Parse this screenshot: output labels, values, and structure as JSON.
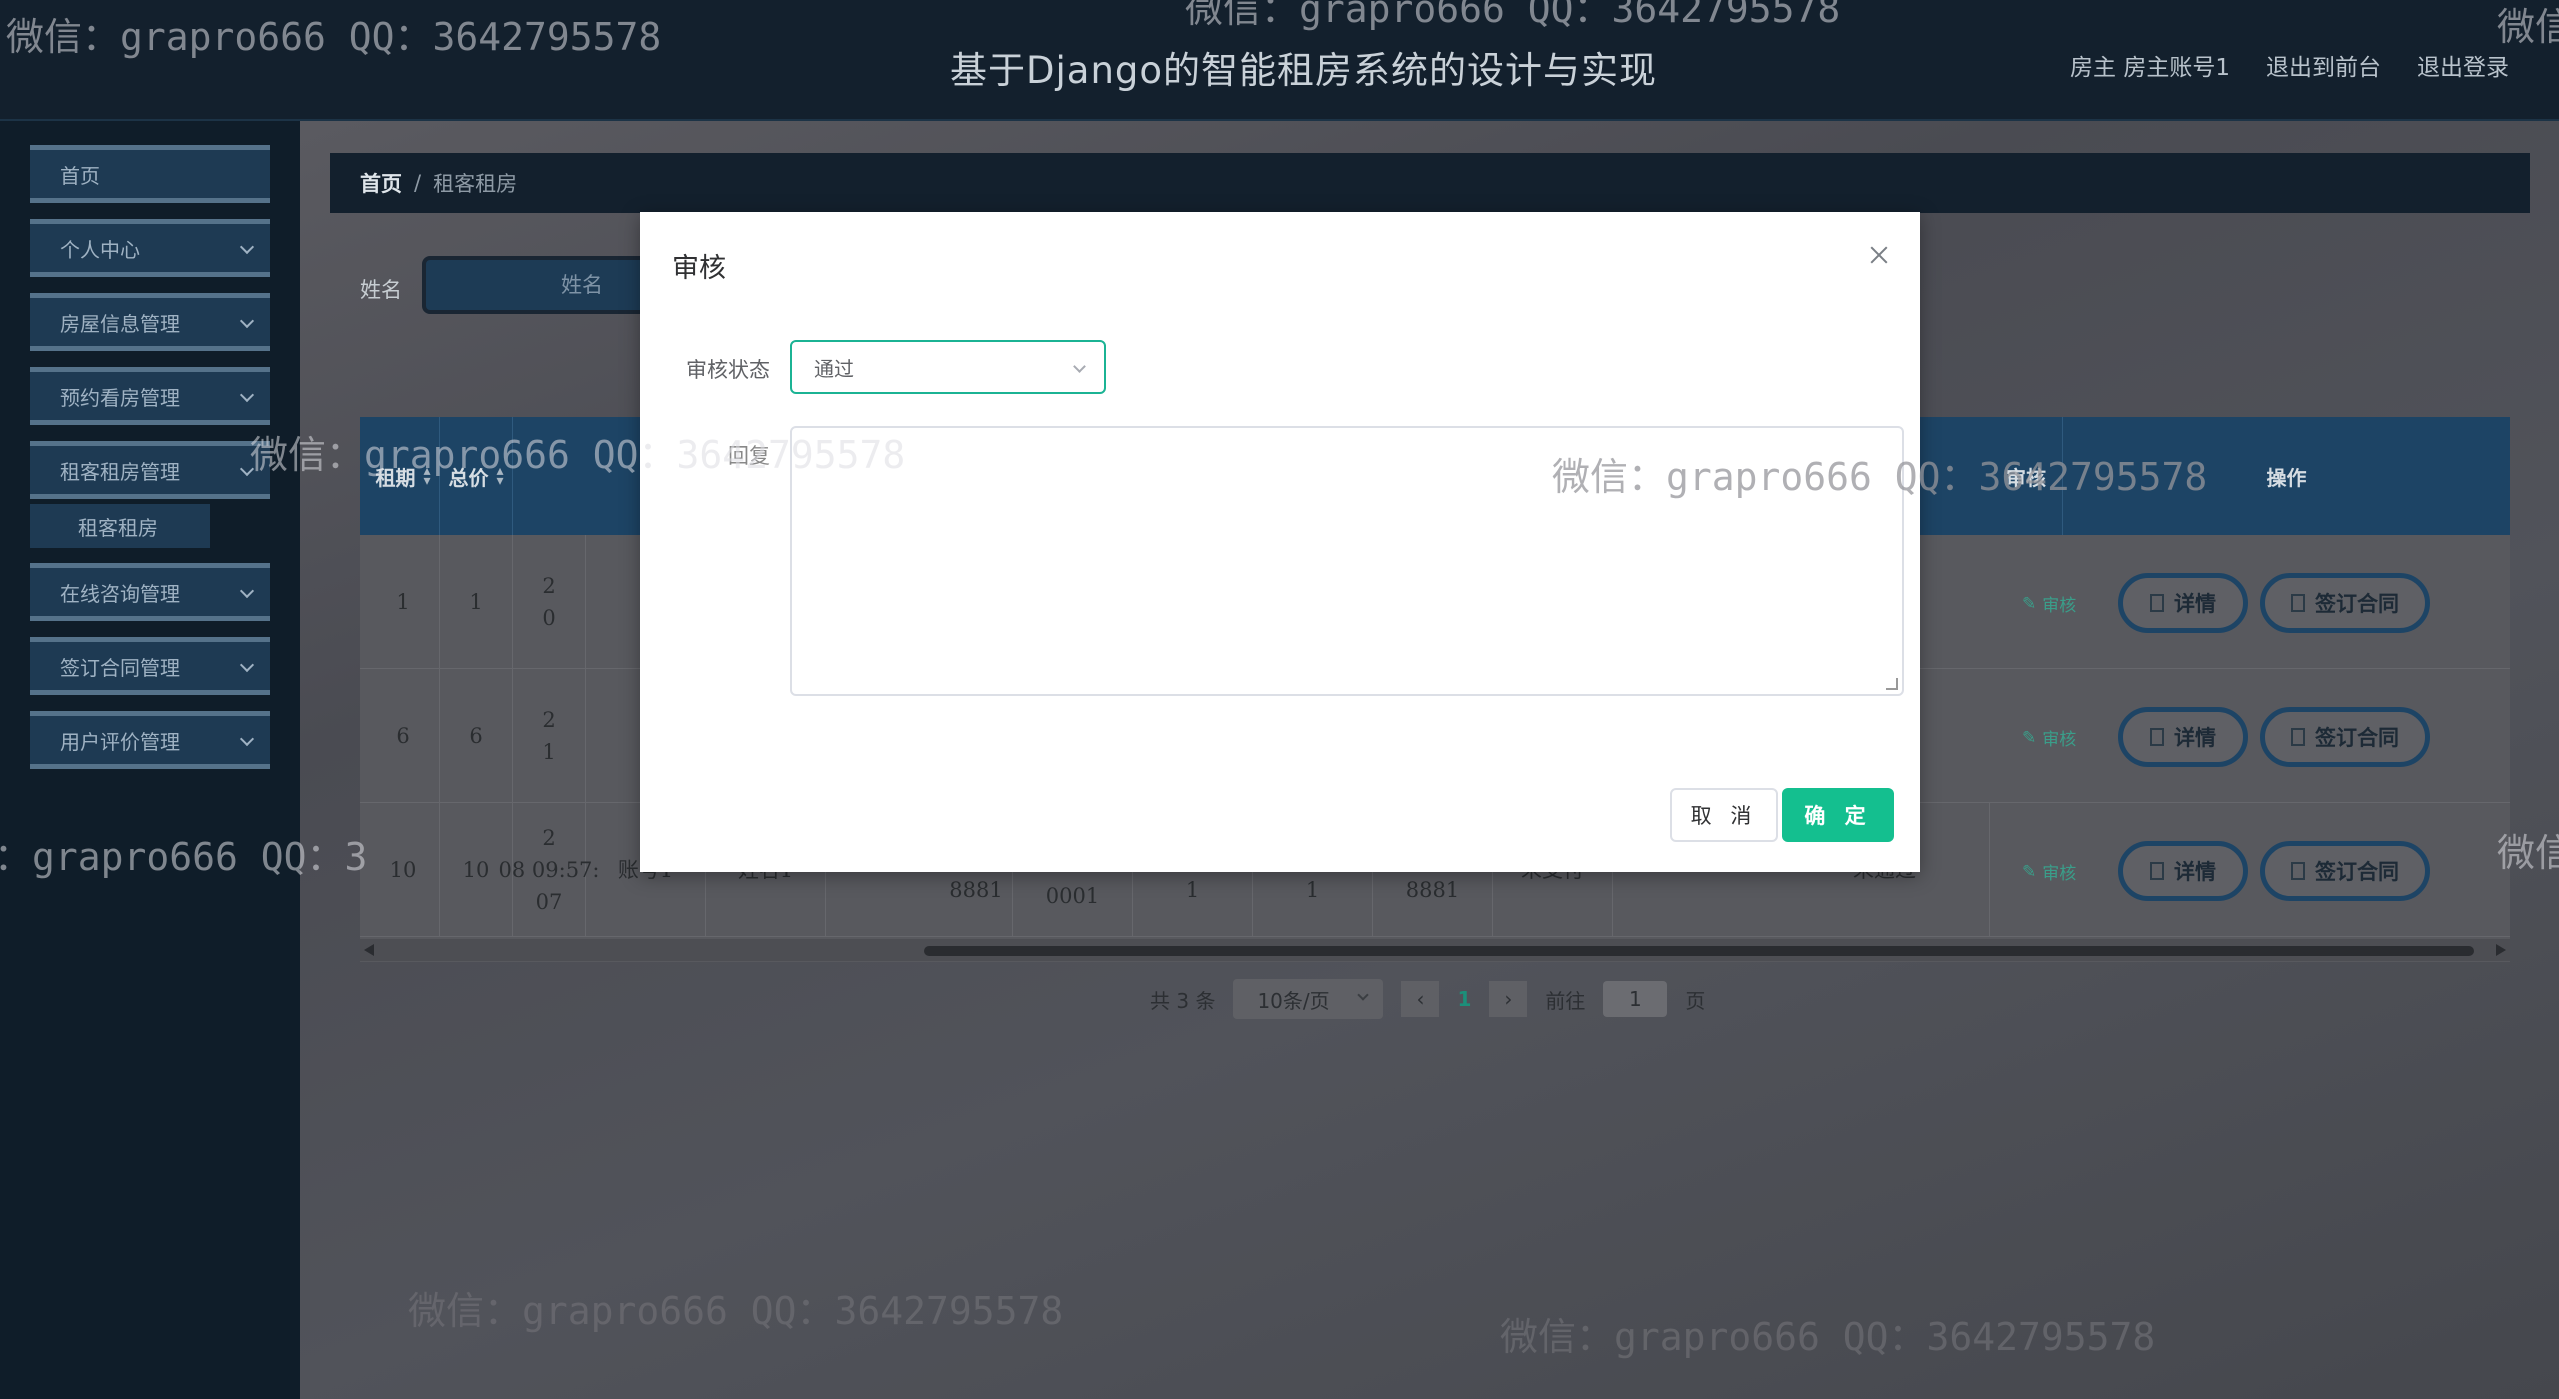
{
  "header": {
    "title": "基于Django的智能租房系统的设计与实现",
    "user_links": [
      "房主 房主账号1",
      "退出到前台",
      "退出登录"
    ]
  },
  "sidebar": {
    "items": [
      {
        "label": "首页",
        "has_arrow": false
      },
      {
        "label": "个人中心",
        "has_arrow": true
      },
      {
        "label": "房屋信息管理",
        "has_arrow": true
      },
      {
        "label": "预约看房管理",
        "has_arrow": true
      },
      {
        "label": "租客租房管理",
        "has_arrow": true
      },
      {
        "label": "在线咨询管理",
        "has_arrow": true
      },
      {
        "label": "签订合同管理",
        "has_arrow": true
      },
      {
        "label": "用户评价管理",
        "has_arrow": true
      }
    ],
    "sub_item": "租客租房"
  },
  "breadcrumb": {
    "home": "首页",
    "separator": "/",
    "current": "租客租房"
  },
  "search": {
    "label": "姓名",
    "placeholder": "姓名"
  },
  "table": {
    "headers": {
      "term": "租期",
      "total": "总价",
      "audit": "审核",
      "action": "操作"
    },
    "rows": [
      {
        "term": "1",
        "total": "1",
        "date_frag": "2\n0"
      },
      {
        "term": "6",
        "total": "6",
        "date_frag": "2\n1"
      },
      {
        "term": "10",
        "total": "10",
        "date_frag": "2\n08 09:57:\n07",
        "c4": "账号1",
        "c5": "姓名1",
        "c6": "8881",
        "c7": "9910101\n0001",
        "c8": "1",
        "c9": "1",
        "c10": "8881",
        "c11": "未支付",
        "c13": "未通过"
      }
    ],
    "audit_link": "审核",
    "detail_button": "详情",
    "contract_button": "签订合同"
  },
  "pager": {
    "total": "共 3 条",
    "page_size": "10条/页",
    "current_page": "1",
    "goto_label": "前往",
    "goto_value": "1",
    "page_unit": "页"
  },
  "modal": {
    "title": "审核",
    "status_label": "审核状态",
    "status_value": "通过",
    "reply_label": "回复",
    "cancel_label": "取 消",
    "ok_label": "确 定"
  },
  "watermarks": {
    "text": "微信：grapro666 QQ：3642795578",
    "fragment_left": "：grapro666 QQ：3",
    "fragment_right": "微信",
    "fragment_top": "微信：grapro666 QQ：3642795578"
  },
  "colors": {
    "header_bg": "#13202d",
    "sidebar_bg": "#0f1d29",
    "accent": "#14bf8f",
    "table_head": "#1d4465"
  }
}
